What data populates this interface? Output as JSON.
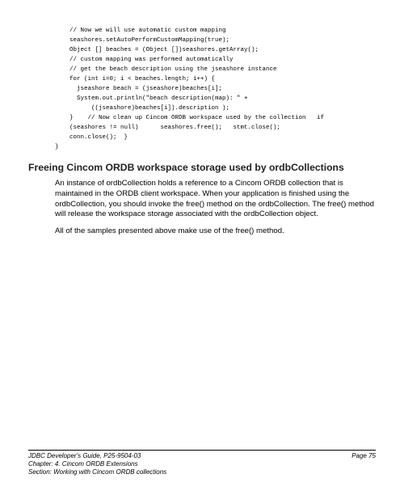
{
  "code": {
    "l1": "    // Now we will use automatic custom mapping",
    "l2": "    seashores.setAutoPerformCustomMapping(true);",
    "l3": "    Object [] beaches = (Object [])seashores.getArray();",
    "l4": "    // custom mapping was performed automatically",
    "l5": "    // get the beach description using the jseashore instance",
    "l6": "    for (int i=0; i < beaches.length; i++) {",
    "l7": "      jseashore beach = (jseashore)beaches[i];",
    "l8": "      System.out.println(\"beach description(map): \" +",
    "l9": "          ((jseashore)beaches[i]).description );",
    "l10": "    }    // Now clean up Cincom ORDB workspace used by the collection   if",
    "l11": "    (seashores != null)      seashores.free();   stmt.close();",
    "l12": "    conn.close();  }",
    "l13": "}"
  },
  "heading": "Freeing Cincom ORDB workspace storage used by ordbCollections",
  "para1": "An instance of ordbCollection holds a reference to a Cincom ORDB collection that is maintained in the ORDB client workspace.  When your application is finished using the ordbCollection, you should invoke the free() method on the ordbCollection.  The free() method will release the workspace storage associated with the ordbCollection object.",
  "para2": "All of the samples presented above make use of the free() method.",
  "footer": {
    "title": "JDBC Developer's Guide, P25-9504-03",
    "chapter": "Chapter: 4. Cincom ORDB Extensions",
    "section": "Section: Working with Cincom ORDB collections",
    "page": "Page 75"
  }
}
